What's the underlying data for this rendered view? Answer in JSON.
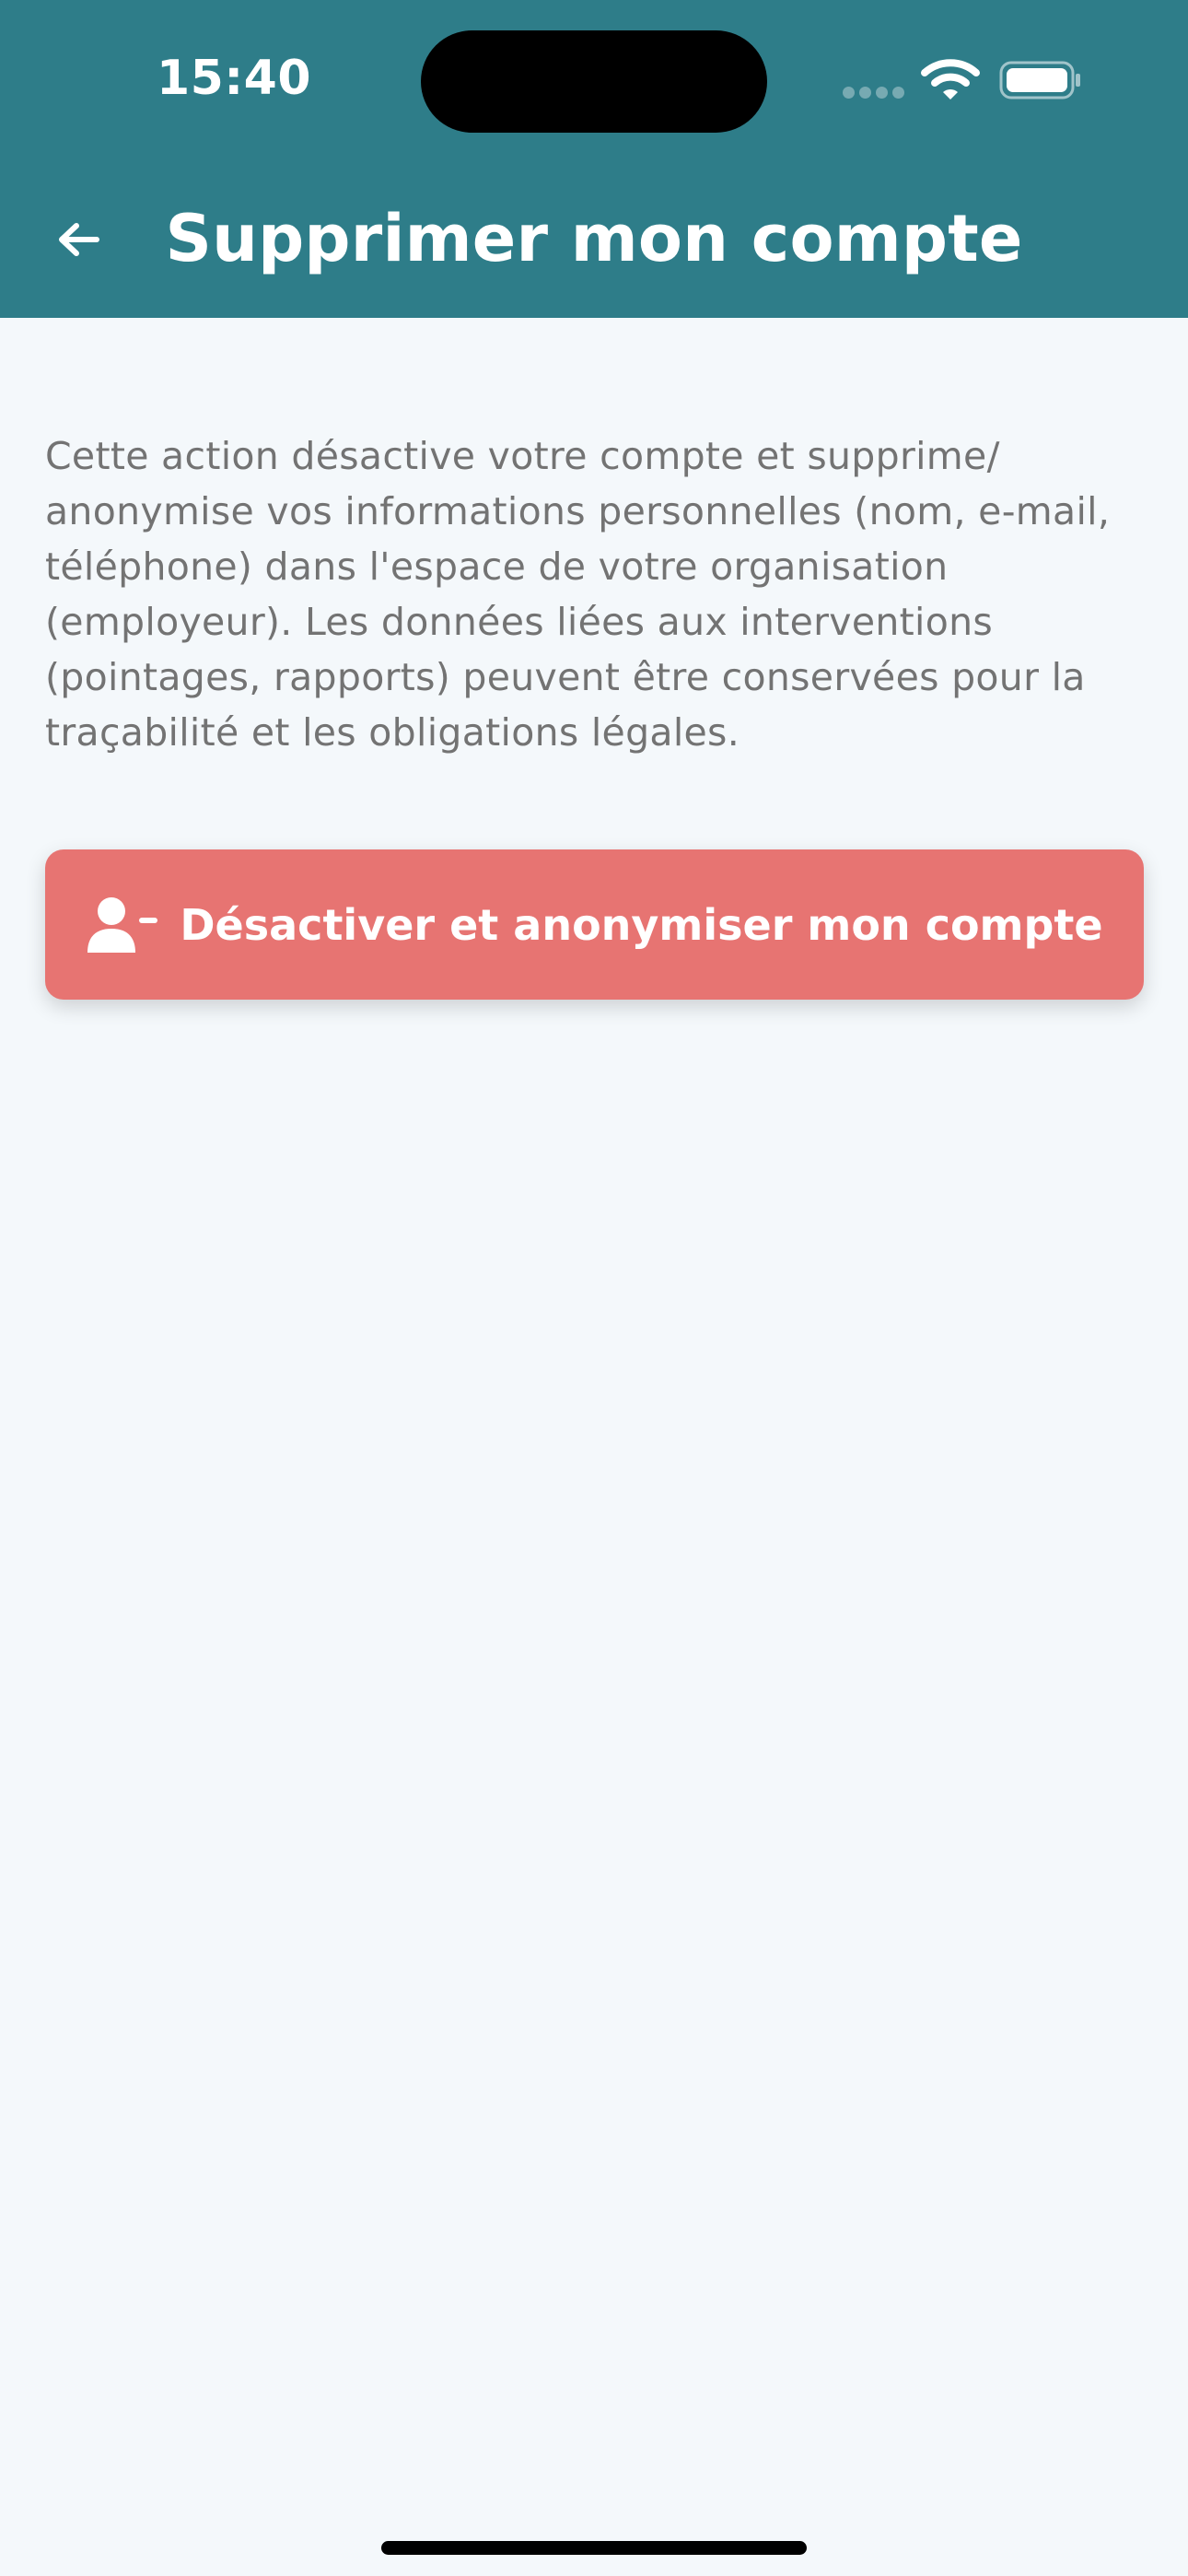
{
  "status_bar": {
    "time": "15:40",
    "icons": [
      "cellular-signal-icon",
      "wifi-icon",
      "battery-icon"
    ]
  },
  "header": {
    "back_icon": "arrow-left-icon",
    "title": "Supprimer mon compte",
    "background_color": "#2e7d89"
  },
  "main": {
    "description_lines": [
      "Cette action désactive votre compte et supprime/",
      "anonymise vos informations personnelles (nom, e-mail,",
      "téléphone) dans l'espace de votre organisation",
      "(employeur). Les données liées aux interventions",
      "(pointages, rapports) peuvent être conservées pour la",
      "traçabilité et les obligations légales."
    ],
    "delete_button": {
      "icon": "user-minus-icon",
      "label": "Désactiver et anonymiser mon compte",
      "color": "#e77472"
    }
  },
  "colors": {
    "page_background": "#f4f8fb",
    "text_muted": "#737373"
  }
}
